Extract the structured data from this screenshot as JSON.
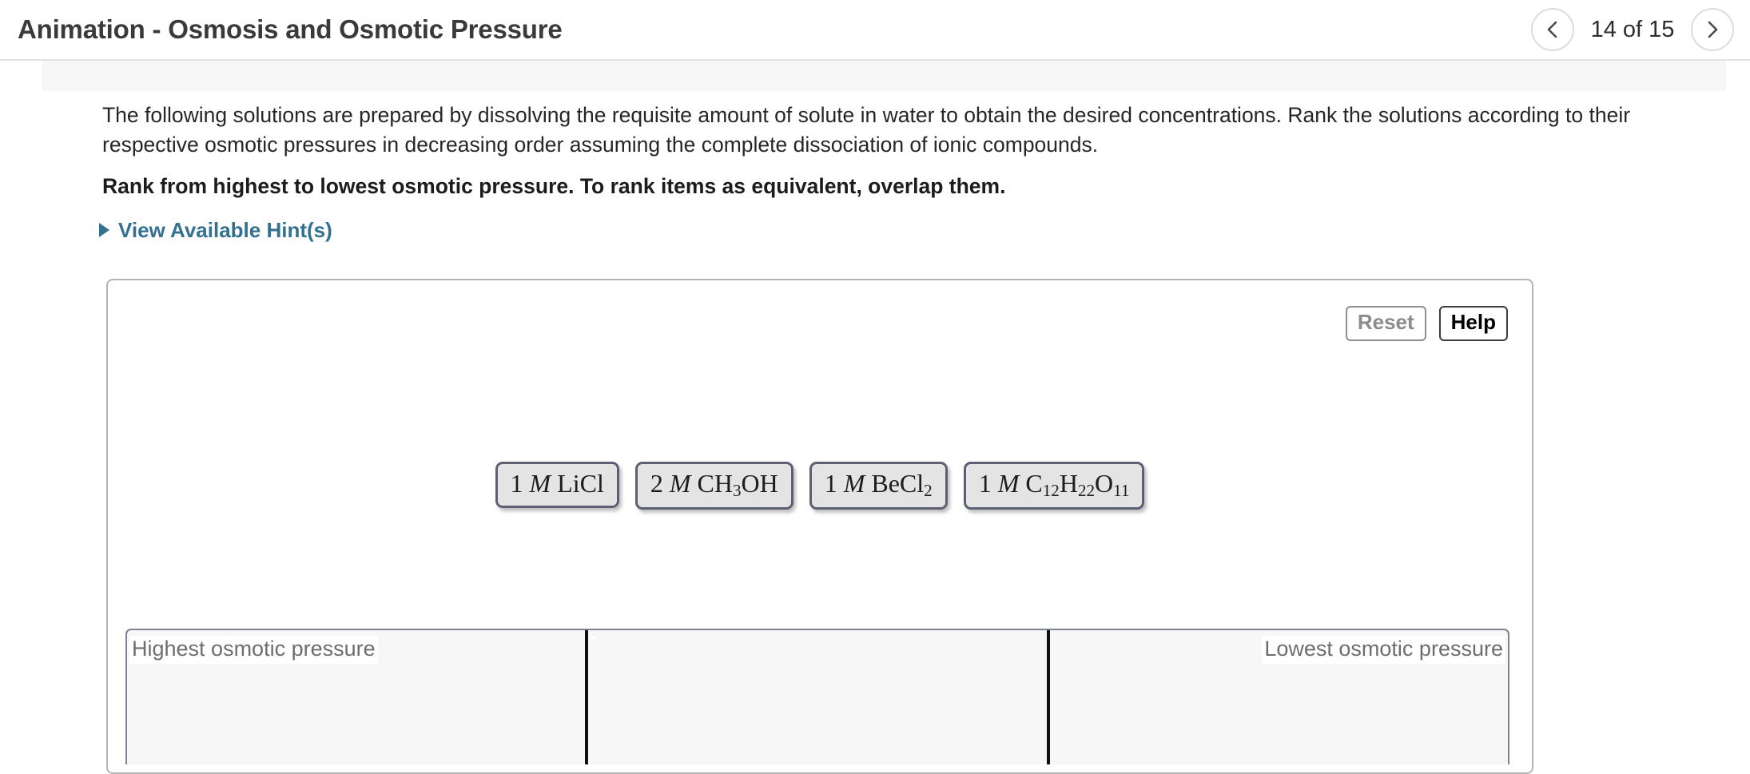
{
  "header": {
    "title": "Animation - Osmosis and Osmotic Pressure",
    "prev_label": "Previous",
    "next_label": "Next",
    "counter": "14 of 15"
  },
  "question": {
    "prompt": "The following solutions are prepared by dissolving the requisite amount of solute in water to obtain the desired concentrations. Rank the solutions according to their respective osmotic pressures in decreasing order assuming the complete dissociation of ionic compounds.",
    "instruction": "Rank from highest to lowest osmotic pressure. To rank items as equivalent, overlap them.",
    "hint_link": "View Available Hint(s)"
  },
  "toolbar": {
    "reset_label": "Reset",
    "help_label": "Help"
  },
  "tiles": [
    {
      "concentration": "1",
      "unit": "M",
      "formula": "LiCl",
      "text": "1 M LiCl"
    },
    {
      "concentration": "2",
      "unit": "M",
      "formula": "CH3OH",
      "text": "2 M CH3OH"
    },
    {
      "concentration": "1",
      "unit": "M",
      "formula": "BeCl2",
      "text": "1 M BeCl2"
    },
    {
      "concentration": "1",
      "unit": "M",
      "formula": "C12H22O11",
      "text": "1 M C12H22O11"
    }
  ],
  "bins": {
    "highest_label": "Highest osmotic pressure",
    "middle_label": "",
    "lowest_label": "Lowest osmotic pressure"
  },
  "colors": {
    "link": "#32718f",
    "tile_border": "#5c6070",
    "tile_fill": "#e4e4e4",
    "bin_fill": "#f7f7f7",
    "panel_border": "#b5b5b5"
  }
}
